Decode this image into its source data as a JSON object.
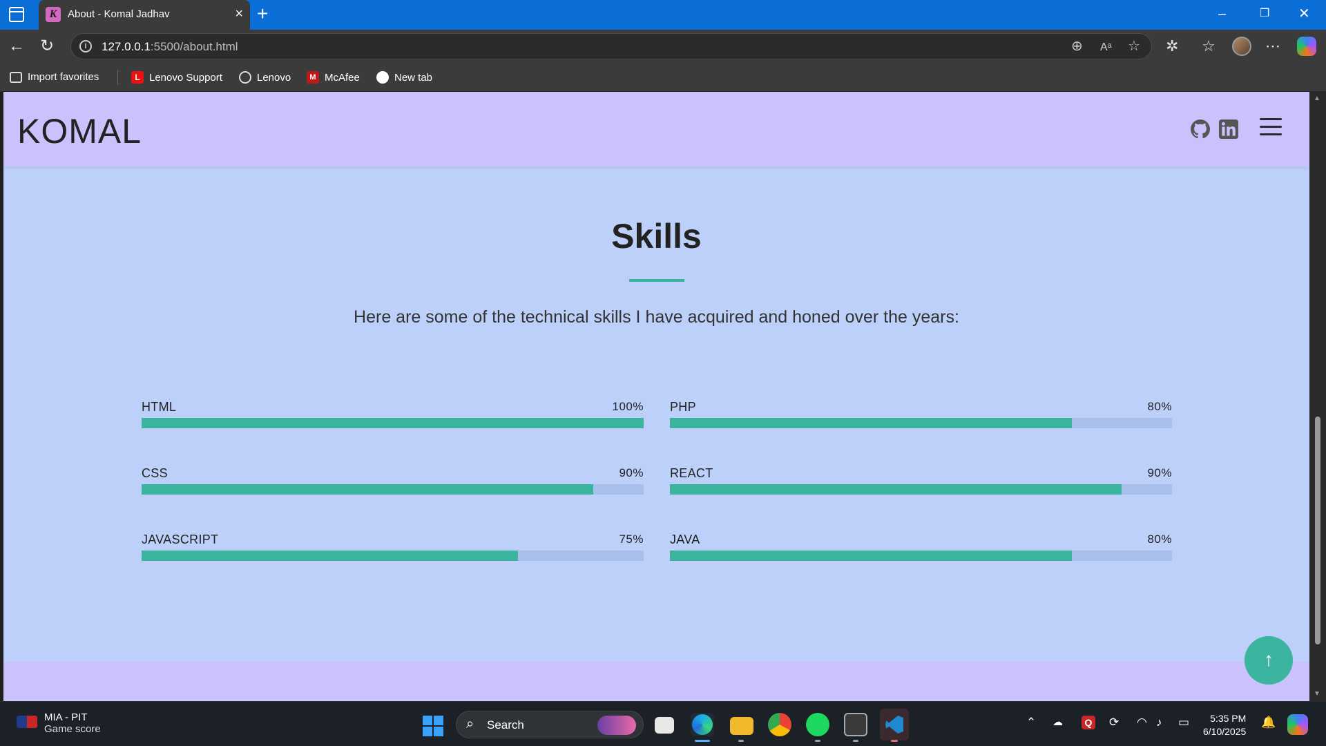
{
  "browser": {
    "tab_title": "About - Komal Jadhav",
    "tab_favicon_letter": "K",
    "url_host": "127.0.0.1",
    "url_path": ":5500/about.html",
    "bookmarks": [
      {
        "label": "Import favorites",
        "icon": "import-icon"
      },
      {
        "label": "Lenovo Support",
        "icon": "lenovo-l-icon"
      },
      {
        "label": "Lenovo",
        "icon": "globe-icon"
      },
      {
        "label": "McAfee",
        "icon": "mcafee-icon"
      },
      {
        "label": "New tab",
        "icon": "circle-icon"
      }
    ]
  },
  "site": {
    "logo": "KOMAL",
    "section_title": "Skills",
    "section_subtitle": "Here are some of the technical skills I have acquired and honed over the years:",
    "accent_color": "#3bb5a0",
    "skills_left": [
      {
        "name": "HTML",
        "percent_label": "100%",
        "percent": 100
      },
      {
        "name": "CSS",
        "percent_label": "90%",
        "percent": 90
      },
      {
        "name": "JAVASCRIPT",
        "percent_label": "75%",
        "percent": 75
      }
    ],
    "skills_right": [
      {
        "name": "PHP",
        "percent_label": "80%",
        "percent": 80
      },
      {
        "name": "REACT",
        "percent_label": "90%",
        "percent": 90
      },
      {
        "name": "JAVA",
        "percent_label": "80%",
        "percent": 80
      }
    ],
    "back_to_top_icon": "arrow-up-icon"
  },
  "taskbar": {
    "widget_title": "MIA - PIT",
    "widget_subtitle": "Game score",
    "search_label": "Search",
    "time": "5:35 PM",
    "date": "6/10/2025"
  }
}
